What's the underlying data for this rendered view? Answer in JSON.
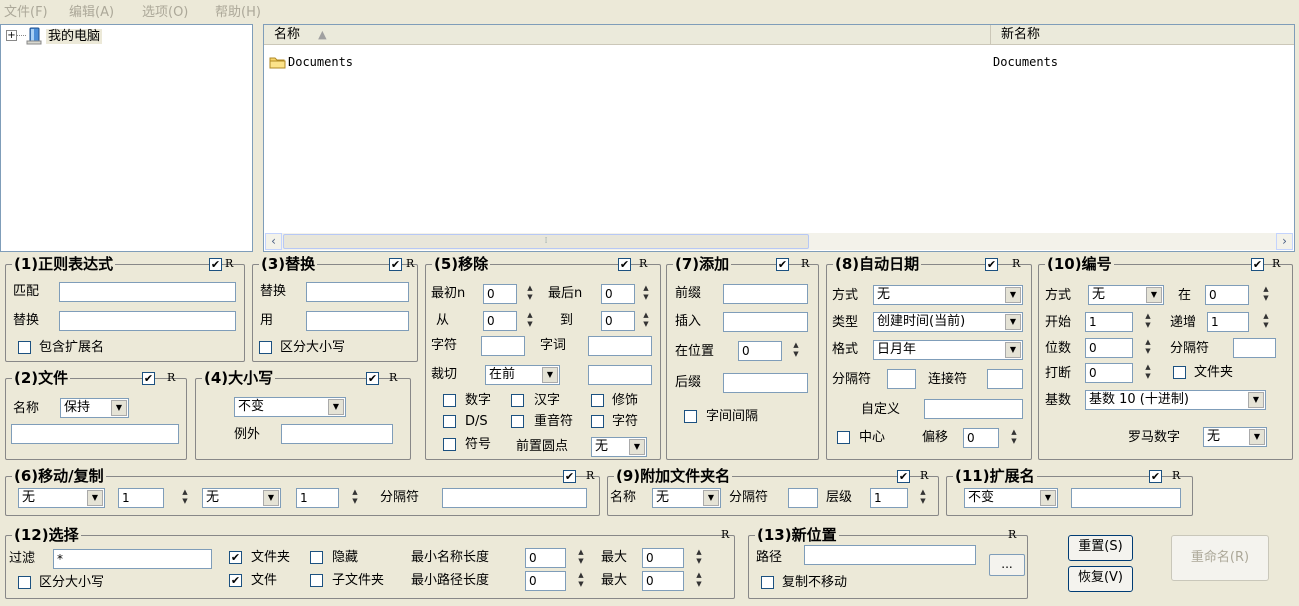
{
  "menu": [
    "文件(F)",
    "编辑(A)",
    "选项(O)",
    "帮助(H)"
  ],
  "tree": {
    "expander": "+",
    "root": "我的电脑"
  },
  "list": {
    "col_name": "名称",
    "sort_indicator": "▲",
    "col_newname": "新名称",
    "rows": [
      {
        "name": "Documents",
        "newname": "Documents"
      }
    ]
  },
  "g1": {
    "title": "(1)正则表达式",
    "match_label": "匹配",
    "match": "",
    "replace_label": "替换",
    "replace": "",
    "ext_label": "包含扩展名",
    "r": "R",
    "check": "✔",
    "dash": "-"
  },
  "g3": {
    "title": "(3)替换",
    "replace_label": "替换",
    "replace": "",
    "with_label": "用",
    "with": "",
    "case_label": "区分大小写",
    "r": "R",
    "check": "✔"
  },
  "g5": {
    "title": "(5)移除",
    "first_label": "最初n",
    "first": "0",
    "last_label": "最后n",
    "last": "0",
    "from_label": "从",
    "from": "0",
    "to_label": "到",
    "to": "0",
    "chars_label": "字符",
    "chars": "",
    "words_label": "字词",
    "words": "",
    "crop_label": "裁切",
    "crop": "在前",
    "crop_val": "",
    "digits": "数字",
    "hanzi": "汉字",
    "trim": "修饰",
    "ds": "D/S",
    "accents": "重音符",
    "chars2": "字符",
    "symbols": "符号",
    "lead_dots": "前置圆点",
    "lead_val": "无",
    "r": "R",
    "check": "✔"
  },
  "g7": {
    "title": "(7)添加",
    "prefix_label": "前缀",
    "prefix": "",
    "insert_label": "插入",
    "insert": "",
    "at_label": "在位置",
    "at": "0",
    "suffix_label": "后缀",
    "suffix": "",
    "space_label": "字间间隔",
    "r": "R",
    "check": "✔"
  },
  "g8": {
    "title": "(8)自动日期",
    "mode_label": "方式",
    "mode": "无",
    "type_label": "类型",
    "type": "创建时间(当前)",
    "fmt_label": "格式",
    "fmt": "日月年",
    "sep_label": "分隔符",
    "sep": "",
    "joiner_label": "连接符",
    "joiner": "",
    "custom_label": "自定义",
    "custom": "",
    "center_label": "中心",
    "offset_label": "偏移",
    "offset": "0",
    "r": "R",
    "check": "✔",
    "dash": "-"
  },
  "g10": {
    "title": "(10)编号",
    "mode_label": "方式",
    "mode": "无",
    "at_label": "在",
    "at": "0",
    "start_label": "开始",
    "start": "1",
    "incr_label": "递增",
    "incr": "1",
    "pad_label": "位数",
    "pad": "0",
    "sep_label": "分隔符",
    "sep": "",
    "break_label": "打断",
    "break": "0",
    "folder_label": "文件夹",
    "base_label": "基数",
    "base": "基数 10 (十进制)",
    "roman_label": "罗马数字",
    "roman": "无",
    "r": "R",
    "check": "✔"
  },
  "g2": {
    "title": "(2)文件",
    "name_label": "名称",
    "name": "保持",
    "value": "",
    "r": "R",
    "check": "✔"
  },
  "g4": {
    "title": "(4)大小写",
    "mode": "不变",
    "except_label": "例外",
    "except": "",
    "r": "R",
    "check": "✔",
    "dash": "-"
  },
  "g6": {
    "title": "(6)移动/复制",
    "from_mode": "无",
    "from_n": "1",
    "to_mode": "无",
    "to_n": "1",
    "sep_label": "分隔符",
    "sep": "",
    "r": "R",
    "check": "✔"
  },
  "g9": {
    "title": "(9)附加文件夹名",
    "name_label": "名称",
    "name": "无",
    "sep_label": "分隔符",
    "sep": "",
    "level_label": "层级",
    "level": "1",
    "r": "R",
    "check": "✔"
  },
  "g11": {
    "title": "(11)扩展名",
    "mode": "不变",
    "value": "",
    "r": "R",
    "check": "✔"
  },
  "g12": {
    "title": "(12)选择",
    "filter_label": "过滤",
    "filter": "*",
    "case_label": "区分大小写",
    "folders_label": "文件夹",
    "hidden_label": "隐藏",
    "files_label": "文件",
    "subfolders_label": "子文件夹",
    "minname_label": "最小名称长度",
    "minname": "0",
    "max1_label": "最大",
    "max1": "0",
    "minpath_label": "最小路径长度",
    "minpath": "0",
    "max2_label": "最大",
    "max2": "0",
    "r": "R",
    "check": "✔"
  },
  "g13": {
    "title": "(13)新位置",
    "path_label": "路径",
    "path": "",
    "browse": "...",
    "copy_label": "复制不移动",
    "r": "R"
  },
  "buttons": {
    "reset": "重置(S)",
    "revert": "恢复(V)",
    "rename": "重命名(R)"
  },
  "glyphs": {
    "up": "▲",
    "down": "▼",
    "left": "‹",
    "right": "›",
    "grip": "⁞"
  }
}
